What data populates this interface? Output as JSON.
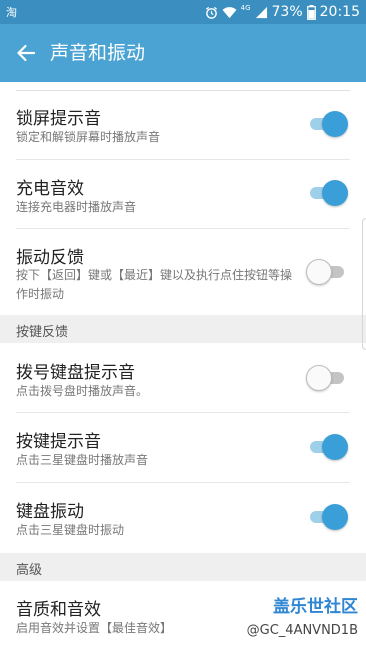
{
  "status_bar": {
    "left_icon": "淘",
    "alarm_icon": "alarm-icon",
    "wifi_icon": "wifi-icon",
    "network": "4G",
    "battery_percent": "73%",
    "time": "20:15"
  },
  "app_bar": {
    "back_icon": "back-arrow-icon",
    "title": "声音和振动"
  },
  "rows": {
    "lock_sound": {
      "title": "锁屏提示音",
      "subtitle": "锁定和解锁屏幕时播放声音",
      "enabled": true
    },
    "charge_sound": {
      "title": "充电音效",
      "subtitle": "连接充电器时播放声音",
      "enabled": true
    },
    "vibration_feedback": {
      "title": "振动反馈",
      "subtitle": "按下【返回】键或【最近】键以及执行点住按钮等操作时振动",
      "enabled": false
    },
    "dialpad_tone": {
      "title": "拨号键盘提示音",
      "subtitle": "点击拨号盘时播放声音。",
      "enabled": false
    },
    "key_tone": {
      "title": "按键提示音",
      "subtitle": "点击三星键盘时播放声音",
      "enabled": true
    },
    "keyboard_vibration": {
      "title": "键盘振动",
      "subtitle": "点击三星键盘时振动",
      "enabled": true
    },
    "sound_quality": {
      "title": "音质和音效",
      "subtitle": "启用音效并设置【最佳音效】"
    }
  },
  "sections": {
    "key_feedback": "按键反馈",
    "advanced": "高级"
  },
  "watermark": {
    "logo_text": "盖乐世社区",
    "user": "@GC_4ANVND1B"
  },
  "colors": {
    "app_bar": "#4aa3d2",
    "status_bar": "#3a8fc0",
    "toggle_on": "#3a9fd8",
    "watermark": "#2f86d3"
  }
}
